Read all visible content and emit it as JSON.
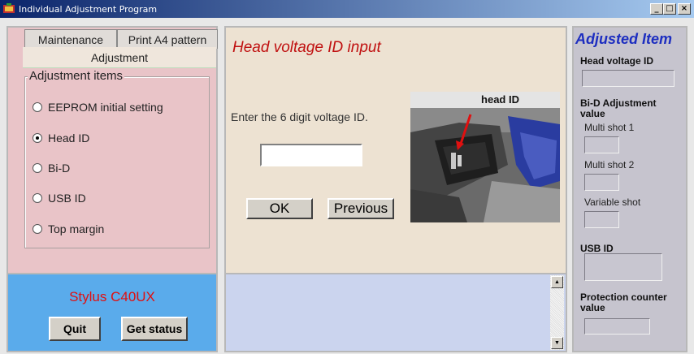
{
  "window": {
    "title": "Individual Adjustment Program",
    "controls": {
      "minimize": "_",
      "maximize": "□",
      "close": "×"
    }
  },
  "left": {
    "tabs": [
      "Maintenance",
      "Print A4 pattern"
    ],
    "active_tab": "Adjustment",
    "group_title": "Adjustment items",
    "items": [
      {
        "label": "EEPROM initial setting",
        "selected": false
      },
      {
        "label": "Head ID",
        "selected": true
      },
      {
        "label": "Bi-D",
        "selected": false
      },
      {
        "label": "USB ID",
        "selected": false
      },
      {
        "label": "Top margin",
        "selected": false
      }
    ]
  },
  "status_panel": {
    "model": "Stylus C40UX",
    "quit_label": "Quit",
    "get_status_label": "Get status"
  },
  "center": {
    "title": "Head voltage ID input",
    "instruction": "Enter the 6 digit voltage ID.",
    "voltage_id_value": "",
    "ok_label": "OK",
    "previous_label": "Previous",
    "photo_label": "head ID"
  },
  "right": {
    "title": "Adjusted Item",
    "head_voltage_label": "Head voltage ID",
    "bid_label": "Bi-D Adjustment value",
    "multi_shot_1": "Multi shot 1",
    "multi_shot_2": "Multi shot 2",
    "variable_shot": "Variable shot",
    "usb_id_label": "USB ID",
    "protection_label": "Protection counter value"
  },
  "colors": {
    "left_panel": "#e9c4c8",
    "center_panel": "#ede2d2",
    "status_panel": "#5aabeb",
    "right_panel": "#c6c4ce",
    "center_title": "#c01010",
    "right_title": "#1d2ec0"
  }
}
